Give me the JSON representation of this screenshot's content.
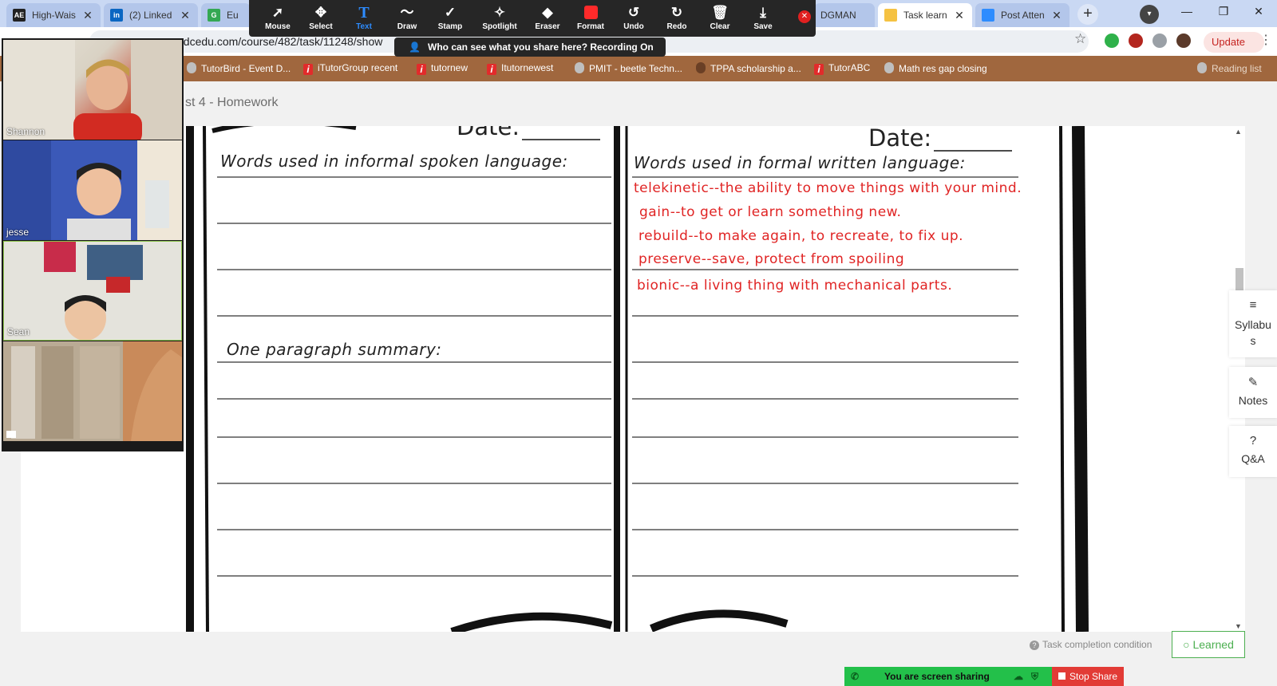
{
  "tabs": [
    {
      "label": "High-Wais",
      "favicon": "AE",
      "color": "#222222"
    },
    {
      "label": "(2) Linked",
      "favicon": "in",
      "color": "#0a66c2"
    },
    {
      "label": "Eu",
      "favicon": "G",
      "color": "#34a853"
    },
    {
      "label": "DGMAN",
      "favicon": "",
      "color": "#b3c6ea"
    },
    {
      "label": "Task learn",
      "favicon": "",
      "color": "#f5c242"
    },
    {
      "label": "Post Atten",
      "favicon": "",
      "color": "#2d8cff"
    }
  ],
  "address_bar": {
    "url": "edcedu.com/course/482/task/11248/show"
  },
  "update_label": "Update",
  "bookmarks": [
    {
      "label": "TutorBird - Event D...",
      "icon": "grey"
    },
    {
      "label": "iTutorGroup recent",
      "icon": "red"
    },
    {
      "label": "tutornew",
      "icon": "red"
    },
    {
      "label": "Itutornewest",
      "icon": "red"
    },
    {
      "label": "PMIT - beetle Techn...",
      "icon": "grey"
    },
    {
      "label": "TPPA scholarship a...",
      "icon": "dark"
    },
    {
      "label": "TutorABC",
      "icon": "red"
    },
    {
      "label": "Math res gap closing",
      "icon": "grey"
    },
    {
      "label": "Reading list",
      "icon": "grey"
    }
  ],
  "page": {
    "title": "st 4 - Homework"
  },
  "worksheet": {
    "date_left": "Date:",
    "date_right": "Date:",
    "left_heading": "Words used in informal spoken language:",
    "right_heading": "Words used in formal written language:",
    "summary_heading": "One paragraph summary:",
    "vocab_notes": [
      "telekinetic--the ability to move things with your mind.",
      "gain--to get or learn something new.",
      "rebuild--to make again, to recreate, to fix up.",
      "preserve--save, protect from spoiling",
      "bionic--a living thing with mechanical parts."
    ]
  },
  "side_panel": {
    "syllabus": "Syllabu s",
    "notes": "Notes",
    "qa": "Q&A"
  },
  "footer": {
    "completion": "Task completion condition",
    "learned": "Learned"
  },
  "zoom": {
    "tools": [
      "Mouse",
      "Select",
      "Text",
      "Draw",
      "Stamp",
      "Spotlight",
      "Eraser",
      "Format",
      "Undo",
      "Redo",
      "Clear",
      "Save"
    ],
    "active_tool": "Text",
    "who_can_see": "Who can see what you share here? Recording On",
    "sharing": "You are screen sharing",
    "stop_share": "Stop Share",
    "participants": [
      "Shannon",
      "jesse",
      "Sean",
      ""
    ]
  }
}
